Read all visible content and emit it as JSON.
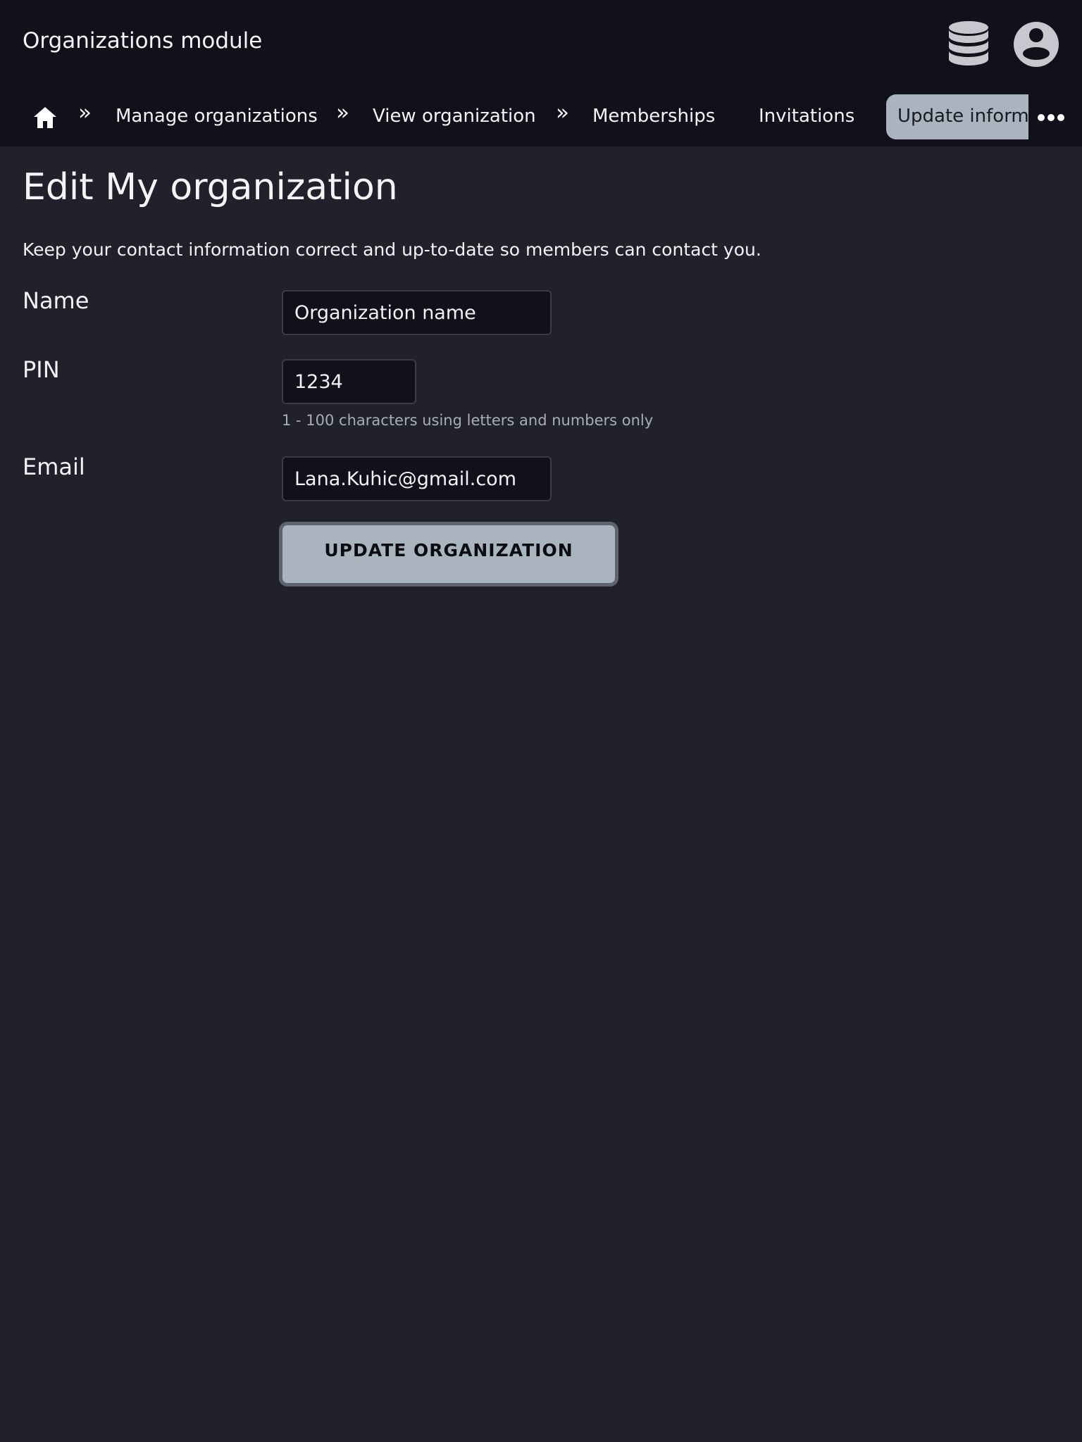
{
  "header": {
    "title": "Organizations module",
    "icons": [
      "database-icon",
      "account-circle-icon"
    ]
  },
  "breadcrumb": {
    "home_icon": "home-icon",
    "separator": "»",
    "items": [
      "Manage organizations",
      "View organization"
    ],
    "tabs": [
      "Memberships",
      "Invitations"
    ],
    "active_tab": "Update inform",
    "overflow_icon": "more-horizontal-icon"
  },
  "page": {
    "title": "Edit My organization",
    "intro": "Keep your contact information correct and up-to-date so members can contact you."
  },
  "form": {
    "name_label": "Name",
    "name_value": "Organization name",
    "pin_label": "PIN",
    "pin_value": "1234",
    "pin_hint": "1 - 100 characters using letters and numbers only",
    "email_label": "Email",
    "email_value": "Lana.Kuhic@gmail.com",
    "submit_label": "UPDATE ORGANIZATION"
  },
  "colors": {
    "background": "#20212b",
    "topbar": "#10111b",
    "accent": "#a9b4bf",
    "input_bg": "#10111b"
  }
}
